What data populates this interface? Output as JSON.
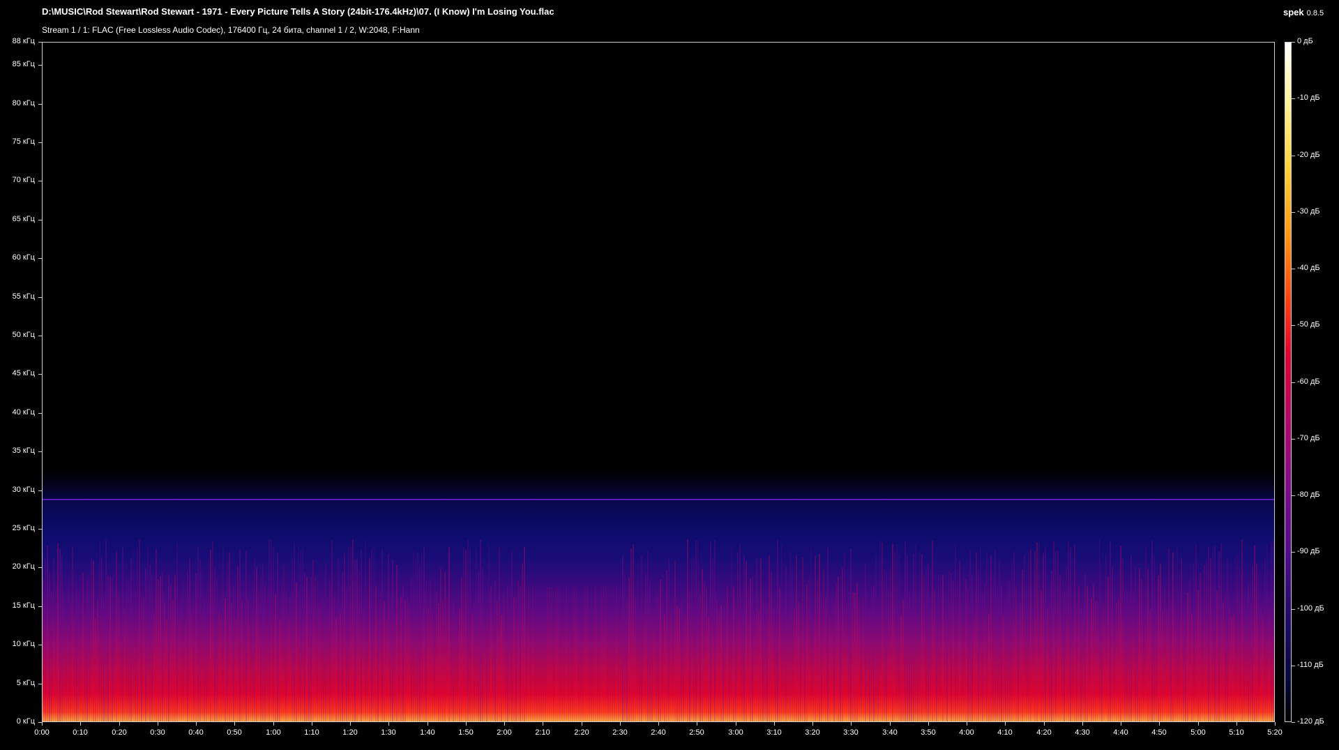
{
  "window": {
    "title": "D:\\MUSIC\\Rod Stewart\\Rod Stewart - 1971 - Every Picture Tells A Story (24bit-176.4kHz)\\07. (I Know) I'm Losing You.flac",
    "subtitle": "Stream 1 / 1: FLAC (Free Lossless Audio Codec), 176400 Гц, 24 бита, channel 1 / 2, W:2048, F:Hann",
    "app_name": "spek",
    "app_version": "0.8.5"
  },
  "spectrogram": {
    "frequency_labels": [
      "88 кГц",
      "85 кГц",
      "80 кГц",
      "75 кГц",
      "70 кГц",
      "65 кГц",
      "60 кГц",
      "55 кГц",
      "50 кГц",
      "45 кГц",
      "40 кГц",
      "35 кГц",
      "30 кГц",
      "25 кГц",
      "20 кГц",
      "15 кГц",
      "10 кГц",
      "5 кГц",
      "0 кГц"
    ],
    "frequency_values_khz": [
      88,
      85,
      80,
      75,
      70,
      65,
      60,
      55,
      50,
      45,
      40,
      35,
      30,
      25,
      20,
      15,
      10,
      5,
      0
    ],
    "frequency_range_khz": [
      0,
      88
    ],
    "time_labels": [
      "0:00",
      "0:10",
      "0:20",
      "0:30",
      "0:40",
      "0:50",
      "1:00",
      "1:10",
      "1:20",
      "1:30",
      "1:40",
      "1:50",
      "2:00",
      "2:10",
      "2:20",
      "2:30",
      "2:40",
      "2:50",
      "3:00",
      "3:10",
      "3:20",
      "3:30",
      "3:40",
      "3:50",
      "4:00",
      "4:10",
      "4:20",
      "4:30",
      "4:40",
      "4:50",
      "5:00",
      "5:10",
      "5:20"
    ],
    "time_values_s": [
      0,
      10,
      20,
      30,
      40,
      50,
      60,
      70,
      80,
      90,
      100,
      110,
      120,
      130,
      140,
      150,
      160,
      170,
      180,
      190,
      200,
      210,
      220,
      230,
      240,
      250,
      260,
      270,
      280,
      290,
      300,
      310,
      320
    ],
    "time_range_s": [
      0,
      320
    ],
    "tone_line_khz": 29,
    "colors": {
      "background": "#000000",
      "low_energy": "#0c0c6a",
      "mid_energy": "#8a0a72",
      "high_energy": "#e0052a",
      "peak": "#ffb040",
      "tone_line": "#6b1bd0"
    }
  },
  "colorbar": {
    "labels": [
      "0 дБ",
      "-10 дБ",
      "-20 дБ",
      "-30 дБ",
      "-40 дБ",
      "-50 дБ",
      "-60 дБ",
      "-70 дБ",
      "-80 дБ",
      "-90 дБ",
      "-100 дБ",
      "-110 дБ",
      "-120 дБ"
    ],
    "values_db": [
      0,
      -10,
      -20,
      -30,
      -40,
      -50,
      -60,
      -70,
      -80,
      -90,
      -100,
      -110,
      -120
    ],
    "range_db": [
      -120,
      0
    ]
  }
}
